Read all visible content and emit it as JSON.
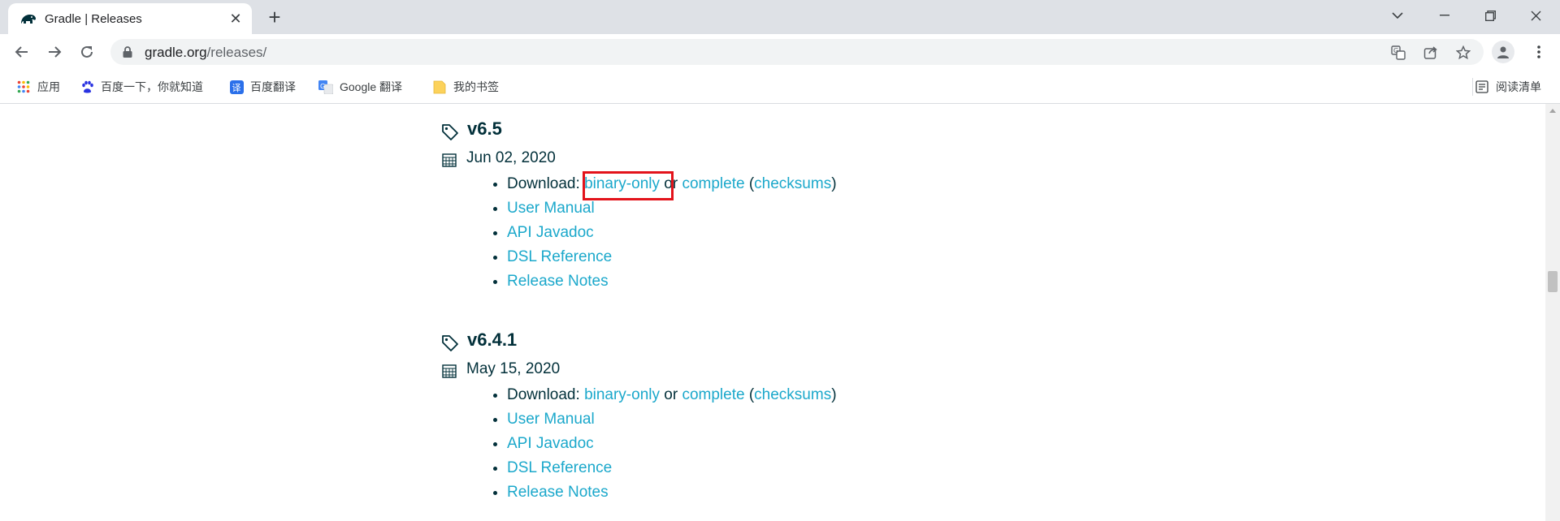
{
  "browser": {
    "tab": {
      "title": "Gradle | Releases",
      "close": "✕"
    },
    "new_tab": "+",
    "url": {
      "host": "gradle.org",
      "path": "/releases/"
    },
    "bookmarks": [
      {
        "label": "应用",
        "icon": "apps-grid-icon"
      },
      {
        "label": "百度一下，你就知道",
        "icon": "baidu-paw-icon"
      },
      {
        "label": "百度翻译",
        "icon": "baidu-translate-icon"
      },
      {
        "label": "Google 翻译",
        "icon": "google-translate-icon"
      },
      {
        "label": "我的书签",
        "icon": "folder-icon"
      }
    ],
    "reading_list": "阅读清单",
    "colors": {
      "tabstrip": "#dee1e6",
      "omnibox": "#f1f3f4",
      "link": "#1ba8cb",
      "highlight": "#e3131b"
    }
  },
  "releases": [
    {
      "version": "v6.5",
      "date": "Jun 02, 2020",
      "download_prefix": "Download: ",
      "binary": "binary-only",
      "or_text": " or ",
      "complete": "complete",
      "paren_open": " (",
      "checksums": "checksums",
      "paren_close": ")",
      "links": [
        "User Manual",
        "API Javadoc",
        "DSL Reference",
        "Release Notes"
      ]
    },
    {
      "version": "v6.4.1",
      "date": "May 15, 2020",
      "download_prefix": "Download: ",
      "binary": "binary-only",
      "or_text": " or ",
      "complete": "complete",
      "paren_open": " (",
      "checksums": "checksums",
      "paren_close": ")",
      "links": [
        "User Manual",
        "API Javadoc",
        "DSL Reference",
        "Release Notes"
      ]
    }
  ]
}
